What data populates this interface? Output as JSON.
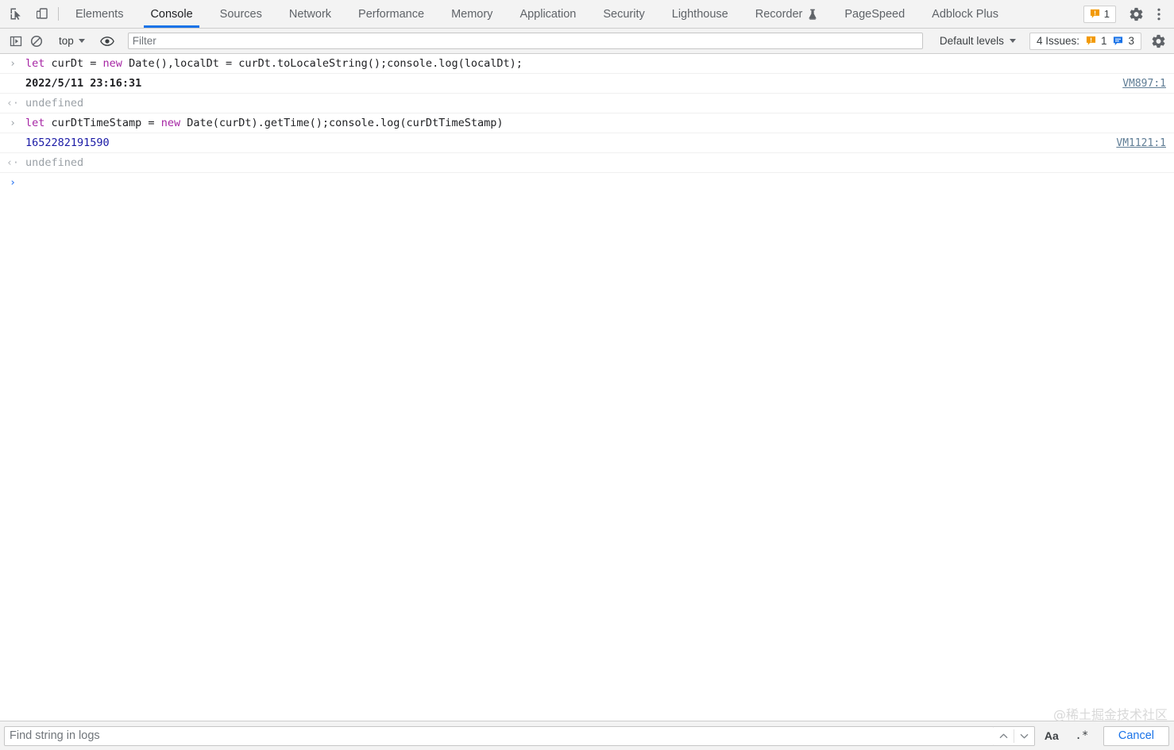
{
  "devtools": {
    "top_toolbar": {
      "inspect_icon": "inspect-element-icon",
      "device_icon": "device-toolbar-icon",
      "tabs": [
        {
          "label": "Elements",
          "selected": false,
          "experimental": false
        },
        {
          "label": "Console",
          "selected": true,
          "experimental": false
        },
        {
          "label": "Sources",
          "selected": false,
          "experimental": false
        },
        {
          "label": "Network",
          "selected": false,
          "experimental": false
        },
        {
          "label": "Performance",
          "selected": false,
          "experimental": false
        },
        {
          "label": "Memory",
          "selected": false,
          "experimental": false
        },
        {
          "label": "Application",
          "selected": false,
          "experimental": false
        },
        {
          "label": "Security",
          "selected": false,
          "experimental": false
        },
        {
          "label": "Lighthouse",
          "selected": false,
          "experimental": false
        },
        {
          "label": "Recorder",
          "selected": false,
          "experimental": true
        },
        {
          "label": "PageSpeed",
          "selected": false,
          "experimental": false
        },
        {
          "label": "Adblock Plus",
          "selected": false,
          "experimental": false
        }
      ],
      "warning_badge_count": "1",
      "settings_icon": "gear-icon",
      "more_icon": "three-dot-menu-icon"
    },
    "console_toolbar": {
      "sidebar_toggle_icon": "console-sidebar-icon",
      "clear_icon": "clear-console-icon",
      "context_label": "top",
      "eye_icon": "live-expression-eye-icon",
      "filter_placeholder": "Filter",
      "filter_value": "",
      "levels_label": "Default levels",
      "issues_label": "4 Issues:",
      "issues_warning_count": "1",
      "issues_info_count": "3",
      "settings_icon": "console-settings-gear-icon"
    },
    "console_rows": [
      {
        "kind": "command",
        "marker": "›",
        "link": "",
        "tokens": [
          {
            "t": "let ",
            "c": "kw-purple"
          },
          {
            "t": "curDt = ",
            "c": "tok-plain"
          },
          {
            "t": "new ",
            "c": "kw-purple"
          },
          {
            "t": "Date(),localDt = curDt.toLocaleString();console.log(localDt);",
            "c": "tok-plain"
          }
        ]
      },
      {
        "kind": "log",
        "marker": "",
        "link": "VM897:1",
        "tokens": [
          {
            "t": "2022/5/11 23:16:31",
            "c": "val-log"
          }
        ]
      },
      {
        "kind": "result",
        "marker": "‹·",
        "link": "",
        "tokens": [
          {
            "t": "undefined",
            "c": "val-undefined"
          }
        ]
      },
      {
        "kind": "command",
        "marker": "›",
        "link": "",
        "tokens": [
          {
            "t": "let ",
            "c": "kw-purple"
          },
          {
            "t": "curDtTimeStamp = ",
            "c": "tok-plain"
          },
          {
            "t": "new ",
            "c": "kw-purple"
          },
          {
            "t": "Date(curDt).getTime();console.log(curDtTimeStamp)",
            "c": "tok-plain"
          }
        ]
      },
      {
        "kind": "log",
        "marker": "",
        "link": "VM1121:1",
        "tokens": [
          {
            "t": "1652282191590",
            "c": "val-number"
          }
        ]
      },
      {
        "kind": "result",
        "marker": "‹·",
        "link": "",
        "tokens": [
          {
            "t": "undefined",
            "c": "val-undefined"
          }
        ]
      },
      {
        "kind": "prompt",
        "marker": "›",
        "link": "",
        "tokens": [
          {
            "t": "",
            "c": "tok-plain"
          }
        ]
      }
    ],
    "search_bar": {
      "placeholder": "Find string in logs",
      "value": "",
      "prev_icon": "chevron-up-icon",
      "next_icon": "chevron-down-icon",
      "match_case_label": "Aa",
      "regex_label": ".*",
      "cancel_label": "Cancel"
    },
    "watermark": "@稀土掘金技术社区",
    "colors": {
      "accent": "#1a73e8",
      "warning": "#f29900",
      "info": "#1a73e8",
      "toolbar_bg": "#f3f3f3",
      "number": "#1a1aa6",
      "keyword": "#a626a4"
    }
  }
}
